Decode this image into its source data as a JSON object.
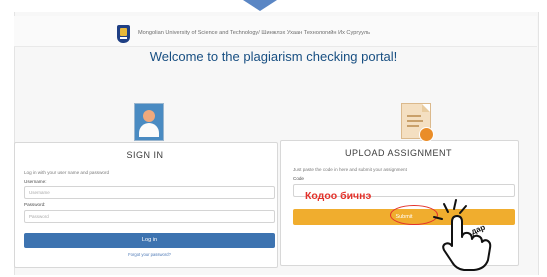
{
  "header": {
    "university_text": "Mongolian University of Science and Technology/ Шинжлэх Ухаан Технологийн Их Сургууль"
  },
  "welcome_text": "Welcome to the plagiarism checking portal!",
  "sign_in": {
    "title": "SIGN IN",
    "hint": "Log in with your user name and password",
    "username_label": "Username:",
    "username_placeholder": "Username",
    "password_label": "Password:",
    "password_placeholder": "Password",
    "login_button": "Log in",
    "forgot_link": "Forgot your password?"
  },
  "upload": {
    "title": "UPLOAD ASSIGNMENT",
    "hint": "Just paste the code in here and submit your assignment",
    "code_label": "Code",
    "code_placeholder": "",
    "submit_button": "Submit"
  },
  "annotations": {
    "code_instruction": "Кодоо бичнэ",
    "tap_label": "дар",
    "accent_color": "#e3322b"
  },
  "colors": {
    "primary_blue": "#3d73b0",
    "submit_orange": "#f0ad2e",
    "title_blue": "#184f82"
  },
  "icons": [
    "user-avatar-icon",
    "document-upload-icon",
    "university-logo",
    "tap-hand-icon"
  ]
}
